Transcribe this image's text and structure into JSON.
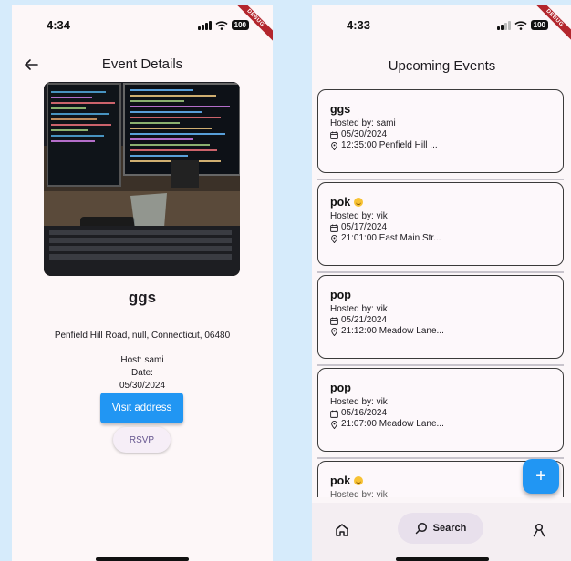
{
  "left_screen": {
    "status": {
      "time": "4:34",
      "battery": "100"
    },
    "debug_label": "DEBUG",
    "appbar_title": "Event Details",
    "event_name": "ggs",
    "address": "Penfield Hill Road, null, Connecticut, 06480",
    "host": "Host: sami",
    "date_label": "Date:",
    "date": "05/30/2024",
    "visit_button": "Visit address",
    "rsvp_button": "RSVP"
  },
  "right_screen": {
    "status": {
      "time": "4:33",
      "battery": "100"
    },
    "debug_label": "DEBUG",
    "title": "Upcoming Events",
    "events": [
      {
        "name": "ggs",
        "emoji": false,
        "host": "Hosted by: sami",
        "date": "05/30/2024",
        "location": "12:35:00 Penfield Hill ..."
      },
      {
        "name": "pok",
        "emoji": true,
        "host": "Hosted by: vik",
        "date": "05/17/2024",
        "location": "21:01:00 East Main Str..."
      },
      {
        "name": "pop",
        "emoji": false,
        "host": "Hosted by: vik",
        "date": "05/21/2024",
        "location": "21:12:00 Meadow Lane..."
      },
      {
        "name": "pop",
        "emoji": false,
        "host": "Hosted by: vik",
        "date": "05/16/2024",
        "location": "21:07:00 Meadow Lane..."
      },
      {
        "name": "pok",
        "emoji": true,
        "host": "Hosted by: vik",
        "date": "",
        "location": ""
      }
    ],
    "fab_label": "+",
    "nav": {
      "search_label": "Search"
    }
  },
  "colors": {
    "primary_blue": "#2196f3",
    "debug_red": "#b3262d",
    "background": "#d6ebfb"
  },
  "icons": [
    "back-arrow-icon",
    "calendar-icon",
    "location-pin-icon",
    "home-icon",
    "search-icon",
    "person-icon",
    "plus-icon",
    "wifi-icon",
    "signal-icon",
    "battery-icon"
  ]
}
